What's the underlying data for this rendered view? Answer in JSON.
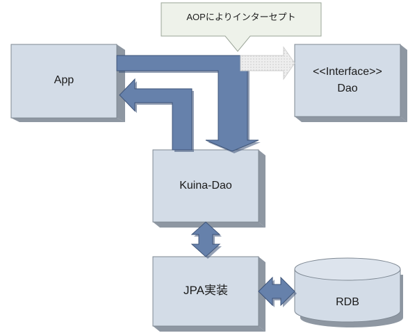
{
  "callout": {
    "text": "AOPによりインターセプト"
  },
  "nodes": {
    "app": {
      "label": "App"
    },
    "interface_dao": {
      "label_line1": "<<Interface>>",
      "label_line2": "Dao"
    },
    "kuina_dao": {
      "label": "Kuina-Dao"
    },
    "jpa": {
      "label": "JPA実装"
    },
    "rdb": {
      "label": "RDB"
    }
  },
  "colors": {
    "box_fill": "#d3dce7",
    "box_shadow": "#8e97a2",
    "box_border": "#7d8792",
    "arrow_fill": "#6681ab",
    "arrow_border": "#3e5478",
    "dashed_arrow_fill": "#e1e1e1",
    "callout_fill": "#eef2ea",
    "callout_border": "#9aa497"
  }
}
